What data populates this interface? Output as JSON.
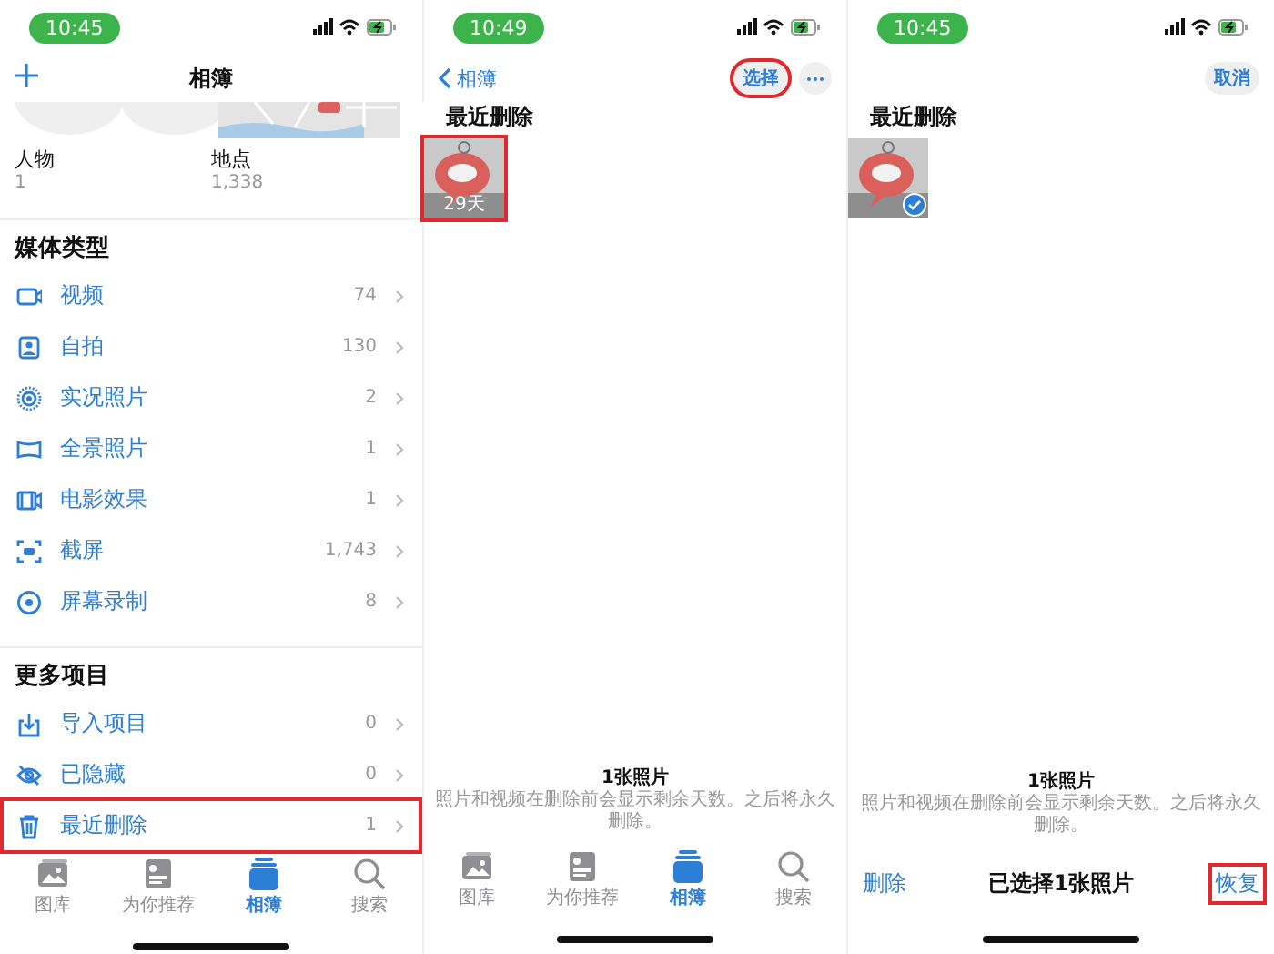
{
  "albums_screen": {
    "status_bar": {
      "time": "10:45"
    },
    "nav": {
      "title": "相簿"
    },
    "albums": [
      {
        "name": "人物",
        "count": "1"
      },
      {
        "name": "地点",
        "count": "1,338"
      }
    ],
    "sections": [
      {
        "title": "媒体类型",
        "rows": [
          {
            "kind": "video",
            "label": "视频",
            "count": "74",
            "highlighted": false
          },
          {
            "kind": "selfie",
            "label": "自拍",
            "count": "130",
            "highlighted": false
          },
          {
            "kind": "live",
            "label": "实况照片",
            "count": "2",
            "highlighted": false
          },
          {
            "kind": "panorama",
            "label": "全景照片",
            "count": "1",
            "highlighted": false
          },
          {
            "kind": "cinematic",
            "label": "电影效果",
            "count": "1",
            "highlighted": false
          },
          {
            "kind": "screenshot",
            "label": "截屏",
            "count": "1,743",
            "highlighted": false
          },
          {
            "kind": "recording",
            "label": "屏幕录制",
            "count": "8",
            "highlighted": false
          }
        ]
      },
      {
        "title": "更多项目",
        "rows": [
          {
            "kind": "import",
            "label": "导入项目",
            "count": "0",
            "highlighted": false
          },
          {
            "kind": "hidden",
            "label": "已隐藏",
            "count": "0",
            "highlighted": false
          },
          {
            "kind": "deleted",
            "label": "最近删除",
            "count": "1",
            "highlighted": true
          }
        ]
      }
    ],
    "tabs": [
      {
        "kind": "library",
        "label": "图库",
        "selected": false
      },
      {
        "kind": "foryou",
        "label": "为你推荐",
        "selected": false
      },
      {
        "kind": "albums",
        "label": "相簿",
        "selected": true
      },
      {
        "kind": "search",
        "label": "搜索",
        "selected": false
      }
    ]
  },
  "deleted_screen": {
    "status_bar": {
      "time": "10:49"
    },
    "back": "相簿",
    "select_button": {
      "label": "选择",
      "highlighted": true
    },
    "title": "最近删除",
    "photos": [
      {
        "days": "29天",
        "highlighted": true
      }
    ],
    "footer": {
      "count": "1张照片",
      "note": "照片和视频在删除前会显示剩余天数。之后将永久删除。"
    },
    "tabs": [
      {
        "kind": "library",
        "label": "图库",
        "selected": false
      },
      {
        "kind": "foryou",
        "label": "为你推荐",
        "selected": false
      },
      {
        "kind": "albums",
        "label": "相簿",
        "selected": true
      },
      {
        "kind": "search",
        "label": "搜索",
        "selected": false
      }
    ]
  },
  "select_screen": {
    "status_bar": {
      "time": "10:45"
    },
    "cancel": "取消",
    "title": "最近删除",
    "photos": [
      {
        "selected": true
      }
    ],
    "footer": {
      "count": "1张照片",
      "note": "照片和视频在删除前会显示剩余天数。之后将永久删除。"
    },
    "toolbar": {
      "delete": "删除",
      "summary": "已选择1张照片",
      "restore": {
        "label": "恢复",
        "highlighted": true
      }
    }
  }
}
